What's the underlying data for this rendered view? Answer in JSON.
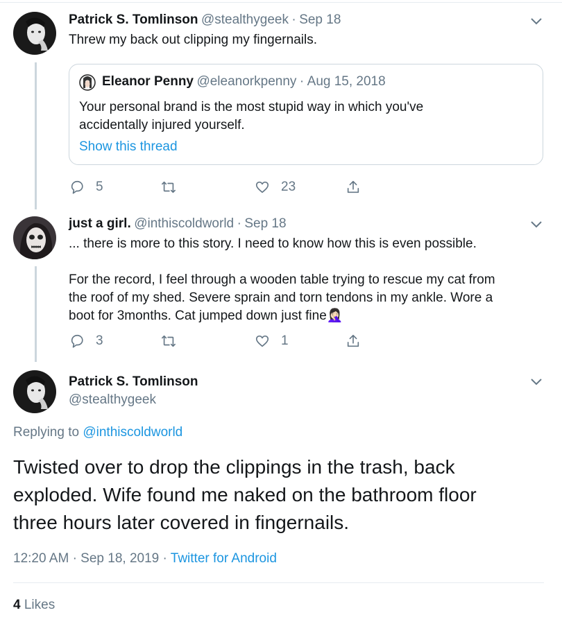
{
  "tweet1": {
    "author_name": "Patrick S. Tomlinson",
    "author_handle": "@stealthygeek",
    "date": "Sep 18",
    "text": "Threw my back out clipping my fingernails.",
    "quote": {
      "author_name": "Eleanor Penny",
      "author_handle": "@eleanorkpenny",
      "date": "Aug 15, 2018",
      "text_line1": "Your personal brand is the most stupid way in which you've",
      "text_line2": "accidentally injured yourself.",
      "show_thread": "Show this thread"
    },
    "replies": "5",
    "likes": "23"
  },
  "tweet2": {
    "author_name": "just a girl.",
    "author_handle": "@inthiscoldworld",
    "date": "Sep 18",
    "text_line1": "... there is more to this story. I need to know how this is even possible.",
    "text_line2": "For the record, I feel through a wooden table trying to rescue my cat from",
    "text_line3": "the roof of my shed. Severe sprain and torn tendons in my ankle. Wore a",
    "text_line4": "boot for 3months. Cat jumped down just fine",
    "emoji": "🤦🏻‍♀️",
    "replies": "3",
    "likes": "1"
  },
  "tweet3": {
    "author_name": "Patrick S. Tomlinson",
    "author_handle": "@stealthygeek",
    "replying_prefix": "Replying to",
    "replying_to": "@inthiscoldworld",
    "text_line1": "Twisted over to drop the clippings in the trash, back",
    "text_line2": "exploded. Wife found me naked on the bathroom floor",
    "text_line3": "three hours later covered in fingernails.",
    "time": "12:20 AM",
    "date": "Sep 18, 2019",
    "source": "Twitter for Android",
    "likes_count": "4",
    "likes_label": "Likes"
  },
  "colors": {
    "link": "#1b95e0",
    "muted": "#657786",
    "text": "#14171a",
    "line": "#ccd6dd"
  }
}
